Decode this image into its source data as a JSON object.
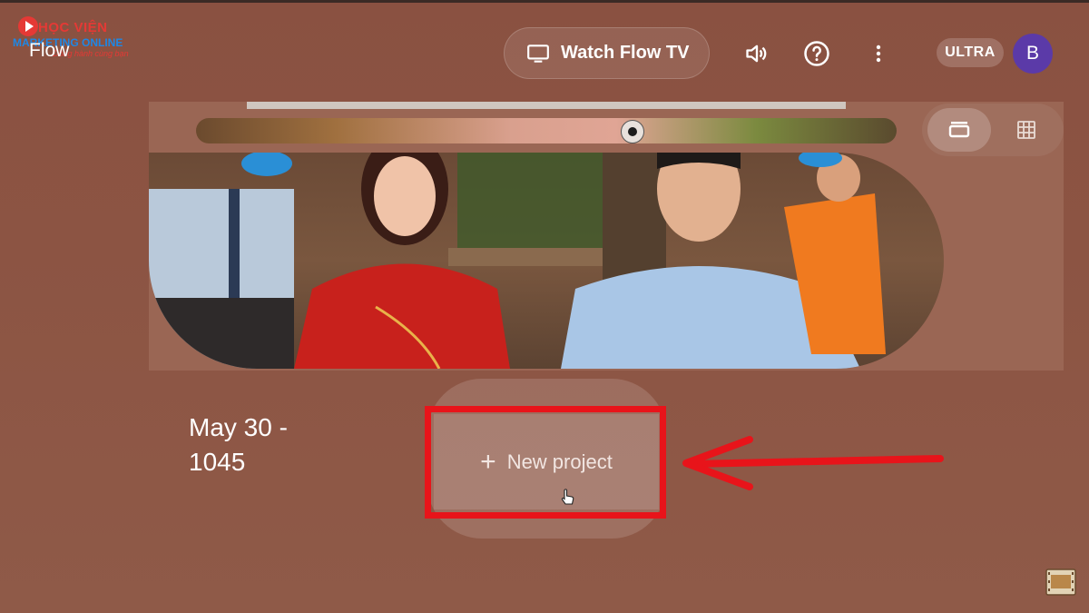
{
  "watermark": {
    "line1": "HỌC VIỆN",
    "line2": "MARKETING ONLINE",
    "line3": "Đồng hành cùng bạn"
  },
  "header": {
    "app_name": "Flow",
    "watch_label": "Watch Flow TV",
    "plan_badge": "ULTRA",
    "avatar_initial": "B"
  },
  "project": {
    "date_title": "May 30 - 1045",
    "new_project_label": "New project"
  },
  "colors": {
    "background": "#8a5141",
    "highlight": "#e8141a",
    "avatar": "#5b3aa8"
  },
  "icons": {
    "watch": "tv-icon",
    "sound": "volume-icon",
    "help": "help-icon",
    "menu": "more-vert-icon",
    "view_list": "view-agenda-icon",
    "view_grid": "grid-view-icon",
    "add": "plus-icon"
  }
}
